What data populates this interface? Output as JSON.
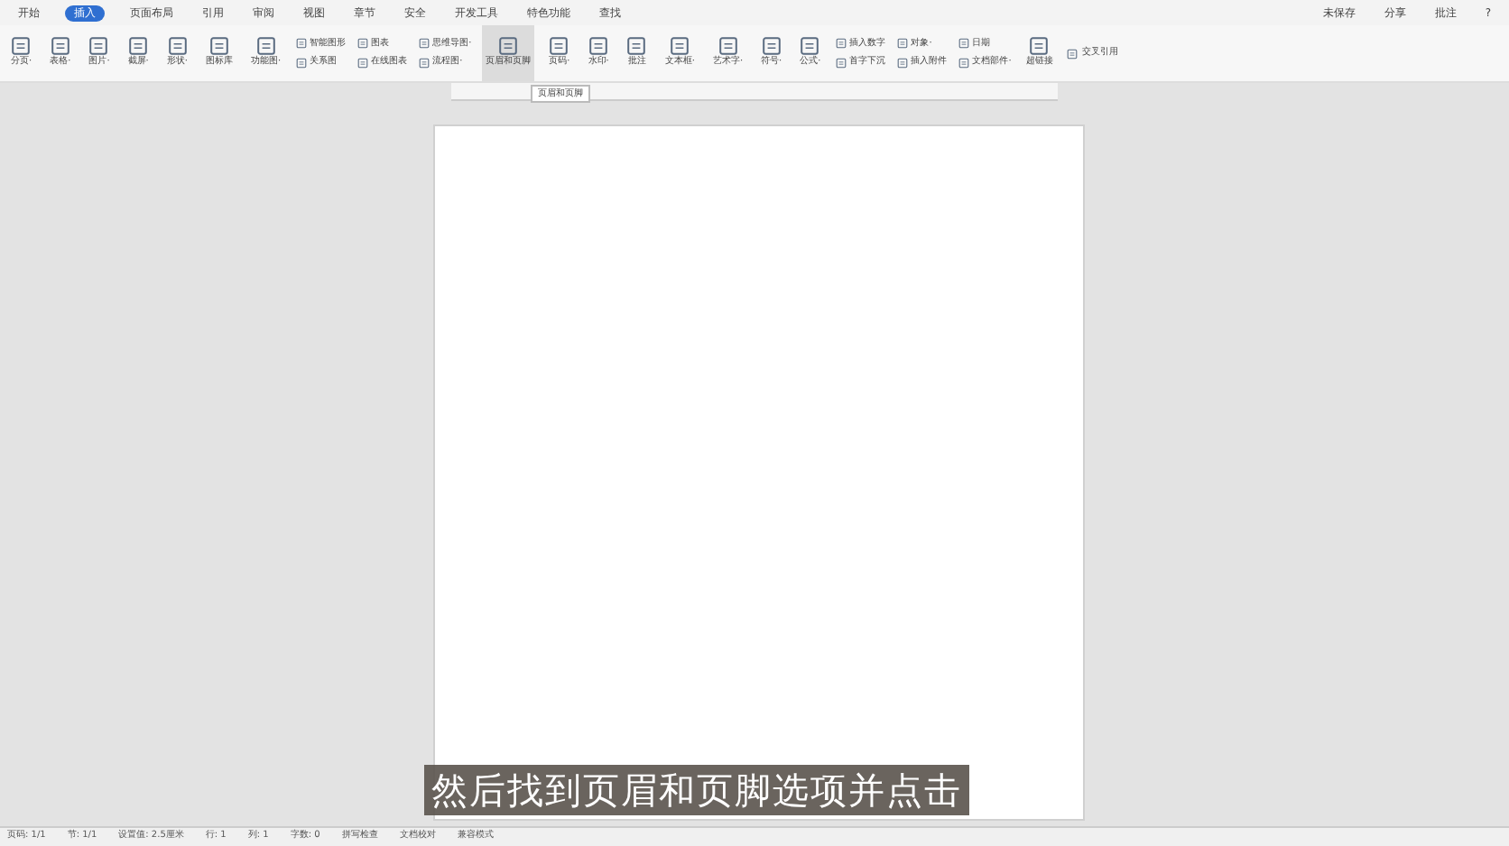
{
  "menu_tabs": [
    {
      "label": "开始",
      "selected": false
    },
    {
      "label": "插入",
      "selected": true
    },
    {
      "label": "页面布局",
      "selected": false
    },
    {
      "label": "引用",
      "selected": false
    },
    {
      "label": "审阅",
      "selected": false
    },
    {
      "label": "视图",
      "selected": false
    },
    {
      "label": "章节",
      "selected": false
    },
    {
      "label": "安全",
      "selected": false
    },
    {
      "label": "开发工具",
      "selected": false
    },
    {
      "label": "特色功能",
      "selected": false
    }
  ],
  "search": {
    "label": "查找"
  },
  "top_right": [
    "未保存",
    "分享",
    "批注",
    "?"
  ],
  "ribbon": [
    {
      "kind": "large",
      "label": "分页·"
    },
    {
      "kind": "large",
      "label": "表格·"
    },
    {
      "kind": "large",
      "label": "图片·"
    },
    {
      "kind": "large",
      "label": "截屏·"
    },
    {
      "kind": "large",
      "label": "形状·"
    },
    {
      "kind": "large",
      "label": "图标库"
    },
    {
      "kind": "large",
      "label": "功能图·"
    },
    {
      "kind": "stack",
      "items": [
        "智能图形",
        "关系图"
      ]
    },
    {
      "kind": "stack",
      "items": [
        "图表",
        "在线图表"
      ]
    },
    {
      "kind": "stack",
      "items": [
        "思维导图·",
        "流程图·"
      ]
    },
    {
      "kind": "large",
      "label": "页眉和页脚",
      "hover": true
    },
    {
      "kind": "large",
      "label": "页码·"
    },
    {
      "kind": "large",
      "label": "水印·"
    },
    {
      "kind": "large",
      "label": "批注"
    },
    {
      "kind": "large",
      "label": "文本框·"
    },
    {
      "kind": "large",
      "label": "艺术字·"
    },
    {
      "kind": "large",
      "label": "符号·"
    },
    {
      "kind": "large",
      "label": "公式·"
    },
    {
      "kind": "stack",
      "items": [
        "插入数字",
        "首字下沉"
      ]
    },
    {
      "kind": "stack",
      "items": [
        "对象·",
        "插入附件"
      ]
    },
    {
      "kind": "stack",
      "items": [
        "日期",
        "文档部件·"
      ]
    },
    {
      "kind": "large",
      "label": "超链接"
    },
    {
      "kind": "stack",
      "items": [
        "交叉引用"
      ]
    }
  ],
  "tooltip": "页眉和页脚",
  "subtitle": "然后找到页眉和页脚选项并点击",
  "status_bar": [
    "页码: 1/1",
    "节: 1/1",
    "设置值: 2.5厘米",
    "行: 1",
    "列: 1",
    "字数: 0",
    "拼写检查",
    "文档校对",
    "兼容模式"
  ]
}
